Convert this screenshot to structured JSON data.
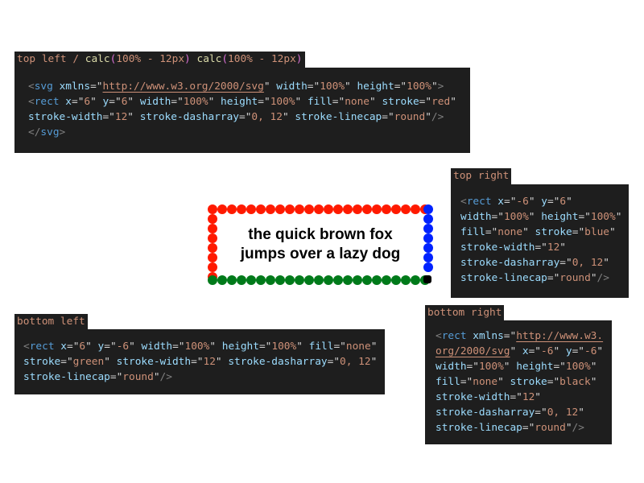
{
  "demo": {
    "text_line1": "the quick brown fox",
    "text_line2": "jumps over a lazy dog",
    "colors": {
      "top": "#ff1a00",
      "right": "#0022ff",
      "bottom": "#007a1a",
      "corner": "#000000"
    }
  },
  "panels": [
    {
      "id": "top-left",
      "label": [
        [
          "plain",
          "top left / "
        ],
        [
          "fn",
          "calc"
        ],
        [
          "paren",
          "("
        ],
        [
          "plain",
          "100% - 12px"
        ],
        [
          "paren",
          ")"
        ],
        [
          "plain",
          " "
        ],
        [
          "fn",
          "calc"
        ],
        [
          "paren",
          "("
        ],
        [
          "plain",
          "100% - 12px"
        ],
        [
          "paren",
          ")"
        ]
      ],
      "lines": [
        [
          [
            "tag",
            "<"
          ],
          [
            "name",
            "svg"
          ],
          [
            "punc",
            " "
          ],
          [
            "attr",
            "xmlns"
          ],
          [
            "punc",
            "=\""
          ],
          [
            "url",
            "http://www.w3.org/2000/svg"
          ],
          [
            "punc",
            "\" "
          ],
          [
            "attr",
            "width"
          ],
          [
            "punc",
            "=\""
          ],
          [
            "str",
            "100%"
          ],
          [
            "punc",
            "\" "
          ],
          [
            "attr",
            "height"
          ],
          [
            "punc",
            "=\""
          ],
          [
            "str",
            "100%"
          ],
          [
            "punc",
            "\""
          ],
          [
            "tag",
            ">"
          ]
        ],
        [
          [
            "tag",
            "<"
          ],
          [
            "name",
            "rect"
          ],
          [
            "punc",
            " "
          ],
          [
            "attr",
            "x"
          ],
          [
            "punc",
            "=\""
          ],
          [
            "str",
            "6"
          ],
          [
            "punc",
            "\" "
          ],
          [
            "attr",
            "y"
          ],
          [
            "punc",
            "=\""
          ],
          [
            "str",
            "6"
          ],
          [
            "punc",
            "\" "
          ],
          [
            "attr",
            "width"
          ],
          [
            "punc",
            "=\""
          ],
          [
            "str",
            "100%"
          ],
          [
            "punc",
            "\" "
          ],
          [
            "attr",
            "height"
          ],
          [
            "punc",
            "=\""
          ],
          [
            "str",
            "100%"
          ],
          [
            "punc",
            "\" "
          ],
          [
            "attr",
            "fill"
          ],
          [
            "punc",
            "=\""
          ],
          [
            "str",
            "none"
          ],
          [
            "punc",
            "\" "
          ],
          [
            "attr",
            "stroke"
          ],
          [
            "punc",
            "=\""
          ],
          [
            "str",
            "red"
          ],
          [
            "punc",
            "\""
          ]
        ],
        [
          [
            "attr",
            "stroke-width"
          ],
          [
            "punc",
            "=\""
          ],
          [
            "str",
            "12"
          ],
          [
            "punc",
            "\" "
          ],
          [
            "attr",
            "stroke-dasharray"
          ],
          [
            "punc",
            "=\""
          ],
          [
            "str",
            "0, 12"
          ],
          [
            "punc",
            "\" "
          ],
          [
            "attr",
            "stroke-linecap"
          ],
          [
            "punc",
            "=\""
          ],
          [
            "str",
            "round"
          ],
          [
            "punc",
            "\""
          ],
          [
            "tag",
            "/>"
          ]
        ],
        [
          [
            "tag",
            "</"
          ],
          [
            "name",
            "svg"
          ],
          [
            "tag",
            ">"
          ]
        ]
      ]
    },
    {
      "id": "top-right",
      "label": [
        [
          "plain",
          "top right"
        ]
      ],
      "lines": [
        [
          [
            "tag",
            "<"
          ],
          [
            "name",
            "rect"
          ],
          [
            "punc",
            " "
          ],
          [
            "attr",
            "x"
          ],
          [
            "punc",
            "=\""
          ],
          [
            "str",
            "-6"
          ],
          [
            "punc",
            "\" "
          ],
          [
            "attr",
            "y"
          ],
          [
            "punc",
            "=\""
          ],
          [
            "str",
            "6"
          ],
          [
            "punc",
            "\""
          ]
        ],
        [
          [
            "attr",
            "width"
          ],
          [
            "punc",
            "=\""
          ],
          [
            "str",
            "100%"
          ],
          [
            "punc",
            "\" "
          ],
          [
            "attr",
            "height"
          ],
          [
            "punc",
            "=\""
          ],
          [
            "str",
            "100%"
          ],
          [
            "punc",
            "\""
          ]
        ],
        [
          [
            "attr",
            "fill"
          ],
          [
            "punc",
            "=\""
          ],
          [
            "str",
            "none"
          ],
          [
            "punc",
            "\" "
          ],
          [
            "attr",
            "stroke"
          ],
          [
            "punc",
            "=\""
          ],
          [
            "str",
            "blue"
          ],
          [
            "punc",
            "\""
          ]
        ],
        [
          [
            "attr",
            "stroke-width"
          ],
          [
            "punc",
            "=\""
          ],
          [
            "str",
            "12"
          ],
          [
            "punc",
            "\""
          ]
        ],
        [
          [
            "attr",
            "stroke-dasharray"
          ],
          [
            "punc",
            "=\""
          ],
          [
            "str",
            "0, 12"
          ],
          [
            "punc",
            "\""
          ]
        ],
        [
          [
            "attr",
            "stroke-linecap"
          ],
          [
            "punc",
            "=\""
          ],
          [
            "str",
            "round"
          ],
          [
            "punc",
            "\""
          ],
          [
            "tag",
            "/>"
          ]
        ]
      ]
    },
    {
      "id": "bottom-left",
      "label": [
        [
          "plain",
          "bottom left"
        ]
      ],
      "lines": [
        [
          [
            "tag",
            "<"
          ],
          [
            "name",
            "rect"
          ],
          [
            "punc",
            " "
          ],
          [
            "attr",
            "x"
          ],
          [
            "punc",
            "=\""
          ],
          [
            "str",
            "6"
          ],
          [
            "punc",
            "\" "
          ],
          [
            "attr",
            "y"
          ],
          [
            "punc",
            "=\""
          ],
          [
            "str",
            "-6"
          ],
          [
            "punc",
            "\" "
          ],
          [
            "attr",
            "width"
          ],
          [
            "punc",
            "=\""
          ],
          [
            "str",
            "100%"
          ],
          [
            "punc",
            "\" "
          ],
          [
            "attr",
            "height"
          ],
          [
            "punc",
            "=\""
          ],
          [
            "str",
            "100%"
          ],
          [
            "punc",
            "\" "
          ],
          [
            "attr",
            "fill"
          ],
          [
            "punc",
            "=\""
          ],
          [
            "str",
            "none"
          ],
          [
            "punc",
            "\""
          ]
        ],
        [
          [
            "attr",
            "stroke"
          ],
          [
            "punc",
            "=\""
          ],
          [
            "str",
            "green"
          ],
          [
            "punc",
            "\" "
          ],
          [
            "attr",
            "stroke-width"
          ],
          [
            "punc",
            "=\""
          ],
          [
            "str",
            "12"
          ],
          [
            "punc",
            "\" "
          ],
          [
            "attr",
            "stroke-dasharray"
          ],
          [
            "punc",
            "=\""
          ],
          [
            "str",
            "0, 12"
          ],
          [
            "punc",
            "\""
          ]
        ],
        [
          [
            "attr",
            "stroke-linecap"
          ],
          [
            "punc",
            "=\""
          ],
          [
            "str",
            "round"
          ],
          [
            "punc",
            "\""
          ],
          [
            "tag",
            "/>"
          ]
        ]
      ]
    },
    {
      "id": "bottom-right",
      "label": [
        [
          "plain",
          "bottom right"
        ]
      ],
      "lines": [
        [
          [
            "tag",
            "<"
          ],
          [
            "name",
            "rect"
          ],
          [
            "punc",
            " "
          ],
          [
            "attr",
            "xmlns"
          ],
          [
            "punc",
            "=\""
          ],
          [
            "url",
            "http://www.w3."
          ]
        ],
        [
          [
            "url",
            "org/2000/svg"
          ],
          [
            "punc",
            "\" "
          ],
          [
            "attr",
            "x"
          ],
          [
            "punc",
            "=\""
          ],
          [
            "str",
            "-6"
          ],
          [
            "punc",
            "\" "
          ],
          [
            "attr",
            "y"
          ],
          [
            "punc",
            "=\""
          ],
          [
            "str",
            "-6"
          ],
          [
            "punc",
            "\""
          ]
        ],
        [
          [
            "attr",
            "width"
          ],
          [
            "punc",
            "=\""
          ],
          [
            "str",
            "100%"
          ],
          [
            "punc",
            "\" "
          ],
          [
            "attr",
            "height"
          ],
          [
            "punc",
            "=\""
          ],
          [
            "str",
            "100%"
          ],
          [
            "punc",
            "\""
          ]
        ],
        [
          [
            "attr",
            "fill"
          ],
          [
            "punc",
            "=\""
          ],
          [
            "str",
            "none"
          ],
          [
            "punc",
            "\" "
          ],
          [
            "attr",
            "stroke"
          ],
          [
            "punc",
            "=\""
          ],
          [
            "str",
            "black"
          ],
          [
            "punc",
            "\""
          ]
        ],
        [
          [
            "attr",
            "stroke-width"
          ],
          [
            "punc",
            "=\""
          ],
          [
            "str",
            "12"
          ],
          [
            "punc",
            "\""
          ]
        ],
        [
          [
            "attr",
            "stroke-dasharray"
          ],
          [
            "punc",
            "=\""
          ],
          [
            "str",
            "0, 12"
          ],
          [
            "punc",
            "\""
          ]
        ],
        [
          [
            "attr",
            "stroke-linecap"
          ],
          [
            "punc",
            "=\""
          ],
          [
            "str",
            "round"
          ],
          [
            "punc",
            "\""
          ],
          [
            "tag",
            "/>"
          ]
        ]
      ]
    }
  ]
}
